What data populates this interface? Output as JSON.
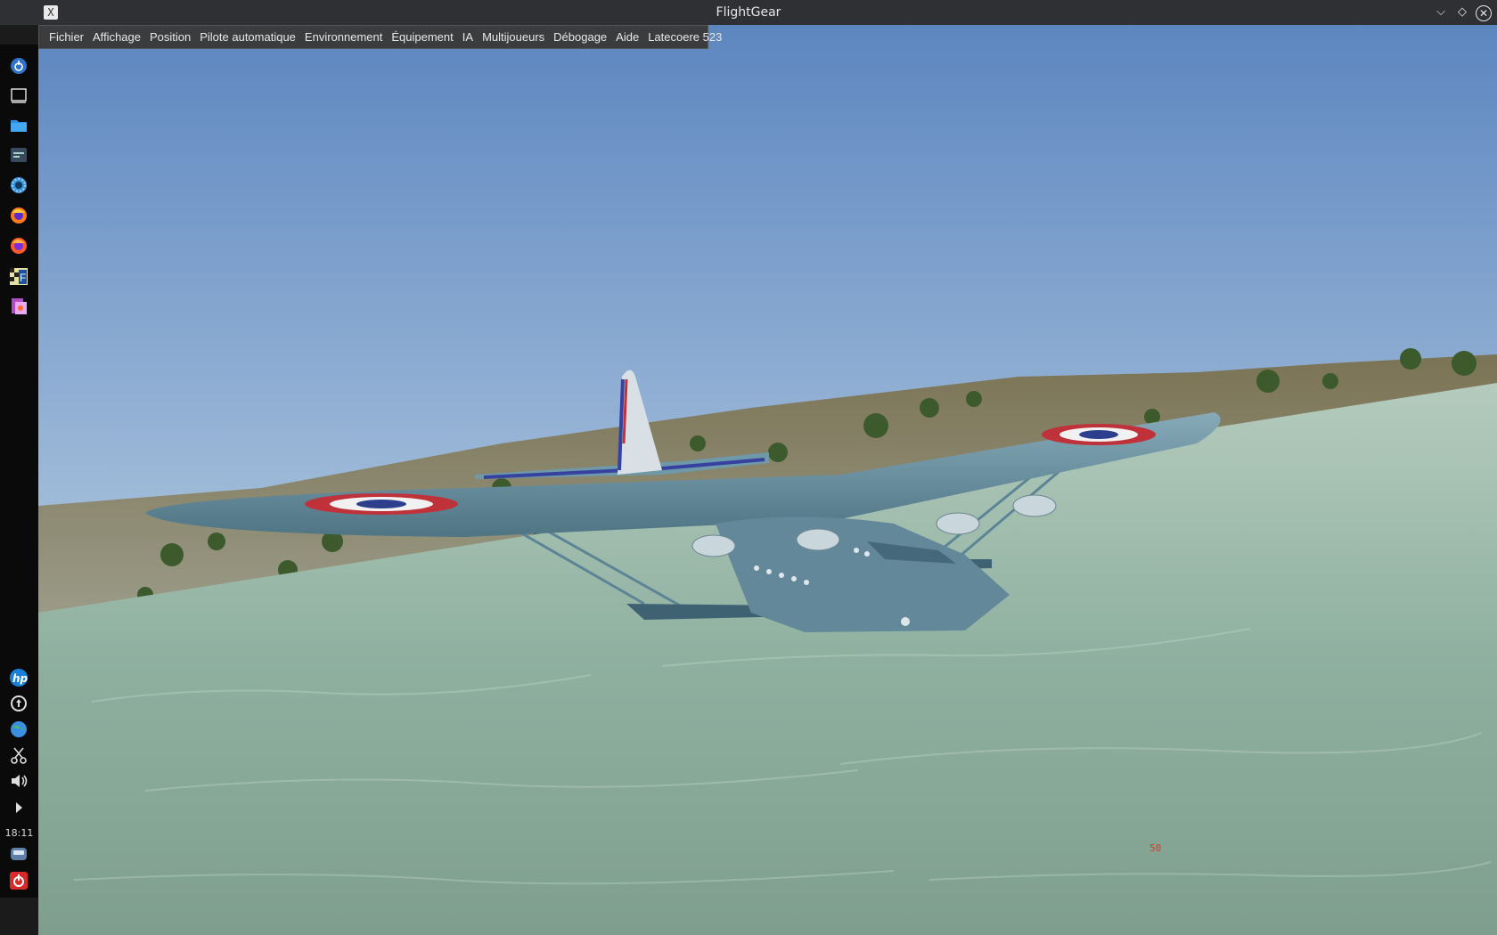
{
  "window": {
    "title": "FlightGear",
    "app_icon_glyph": "X",
    "controls": {
      "minimize": "⌵",
      "maximize": "◇",
      "close": "✕"
    }
  },
  "menu": {
    "items": [
      "Fichier",
      "Affichage",
      "Position",
      "Pilote automatique",
      "Environnement",
      "Équipement",
      "IA",
      "Multijoueurs",
      "Débogage",
      "Aide",
      "Latecoere 523"
    ]
  },
  "dock": {
    "top_icons": [
      "launcher-icon",
      "desktop-icon",
      "files-icon",
      "settings-panel-icon",
      "system-settings-icon",
      "firefox-icon",
      "firefox-alt-icon",
      "flightgear-icon",
      "document-viewer-icon"
    ],
    "bottom_icons": [
      "hp-icon",
      "updates-icon",
      "network-icon",
      "scissors-icon",
      "volume-icon",
      "expand-arrow-icon"
    ],
    "clock": "18:11",
    "tray_icons": [
      "drive-icon",
      "power-icon"
    ]
  },
  "hud": {
    "value": "50"
  },
  "colors": {
    "sky_top": "#5d86c0",
    "sky_bottom": "#bcd3e4",
    "water": "#8fb0a0",
    "hill": "#7b7355",
    "aircraft": "#6f98a8",
    "roundel_red": "#c0323a",
    "roundel_blue": "#2d3f8c"
  }
}
